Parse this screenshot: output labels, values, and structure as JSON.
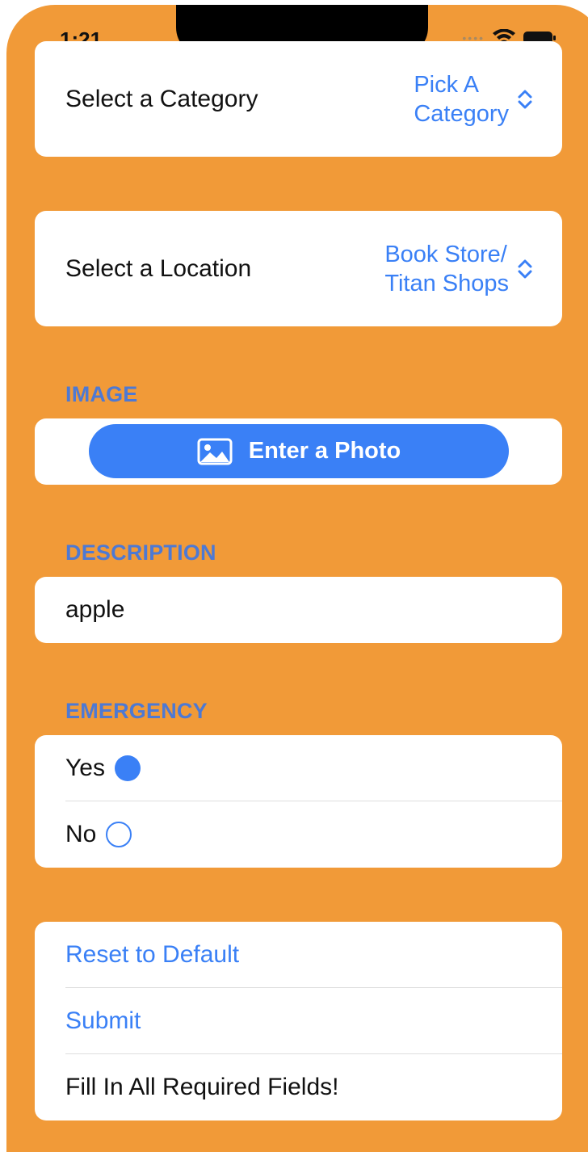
{
  "status_bar": {
    "time": "1:21"
  },
  "category": {
    "label": "Select a Category",
    "value": "Pick A\nCategory"
  },
  "location": {
    "label": "Select a Location",
    "value": "Book Store/\nTitan Shops"
  },
  "image_section": {
    "header": "IMAGE",
    "button_label": "Enter a Photo"
  },
  "description_section": {
    "header": "DESCRIPTION",
    "value": "apple"
  },
  "emergency_section": {
    "header": "EMERGENCY",
    "options": [
      {
        "label": "Yes",
        "selected": true
      },
      {
        "label": "No",
        "selected": false
      }
    ]
  },
  "actions": {
    "reset_label": "Reset to Default",
    "submit_label": "Submit",
    "message": "Fill In All Required Fields!"
  },
  "colors": {
    "accent": "#3a80f6",
    "background": "#F19A38",
    "section_header": "#4d79d4"
  },
  "icons": [
    "wifi-icon",
    "battery-icon",
    "chevron-updown-icon",
    "photo-icon"
  ]
}
